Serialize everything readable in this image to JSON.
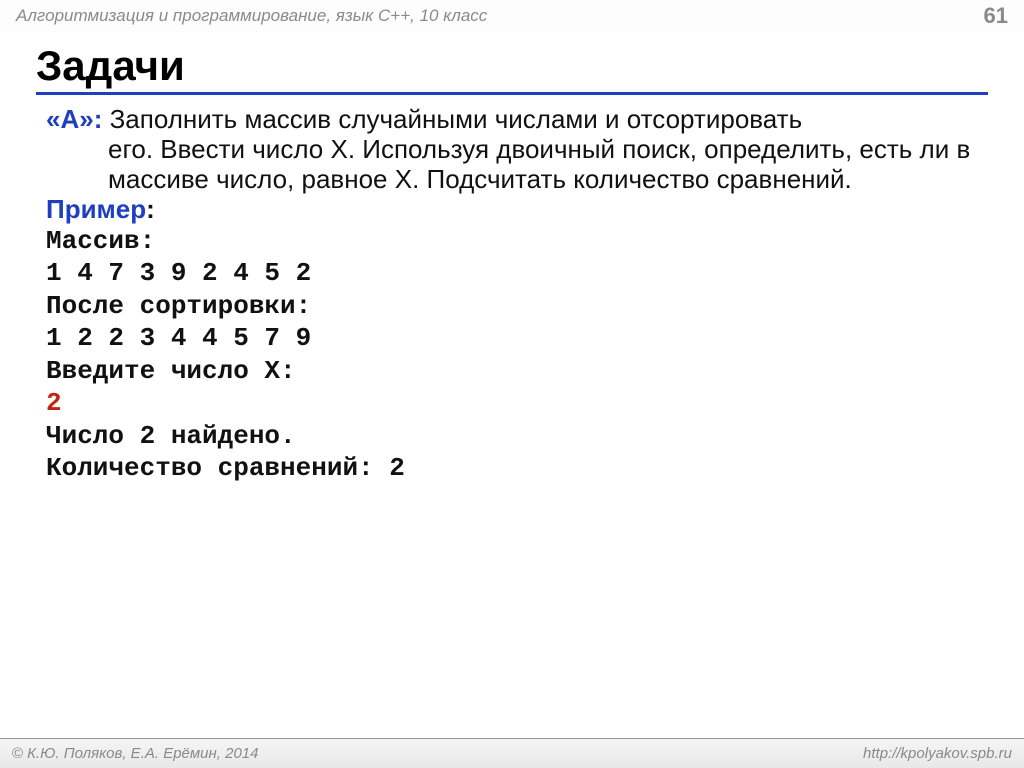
{
  "header": {
    "left": "Алгоритмизация и программирование, язык C++, 10 класс",
    "page_number": "61"
  },
  "title": "Задачи",
  "task": {
    "label": "«A»:",
    "first_line": " Заполнить массив случайными числами и отсортировать",
    "rest": "его.  Ввести число X. Используя двоичный поиск, определить, есть ли в массиве число, равное X. Подсчитать количество сравнений."
  },
  "example": {
    "label": "Пример",
    "colon": ":",
    "lines": {
      "array_label": "Массив:",
      "array_values": "1 4 7 3 9 2 4 5 2",
      "sorted_label": "После сортировки:",
      "sorted_values": "1 2 2 3 4 4 5 7 9",
      "input_prompt": "Введите число X:",
      "input_value": "2",
      "found": "Число 2 найдено.",
      "comparisons": "Количество сравнений: 2"
    }
  },
  "footer": {
    "copyright": "К.Ю. Поляков, Е.А. Ерёмин, 2014",
    "url": "http://kpolyakov.spb.ru"
  }
}
